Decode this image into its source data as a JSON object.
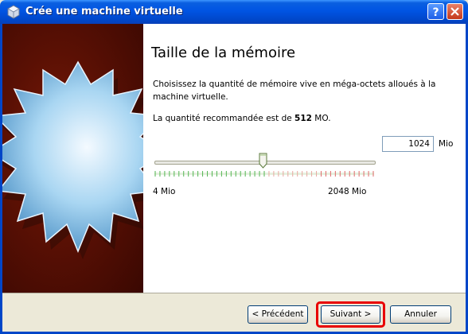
{
  "window": {
    "title": "Crée une machine virtuelle",
    "help_label": "?",
    "close_label": "✕"
  },
  "page": {
    "heading": "Taille de la mémoire",
    "description": "Choisissez la quantité de mémoire vive en méga-octets alloués à la machine virtuelle.",
    "recommended_prefix": "La quantité recommandée est de ",
    "recommended_value": "512",
    "recommended_suffix": " MO."
  },
  "memory": {
    "slider_min_label": "4 Mio",
    "slider_max_label": "2048 Mio",
    "slider_value_fraction": 0.5,
    "value": "1024",
    "unit": "Mio"
  },
  "buttons": {
    "previous": "< Précédent",
    "next": "Suivant >",
    "cancel": "Annuler"
  },
  "colors": {
    "titlebar": "#0054e3",
    "highlight": "#e80000",
    "tick_green": "#52b552",
    "tick_red": "#e06a6a"
  },
  "icons": {
    "window_icon": "virtualbox-icon",
    "banner_icon": "starburst-icon"
  }
}
